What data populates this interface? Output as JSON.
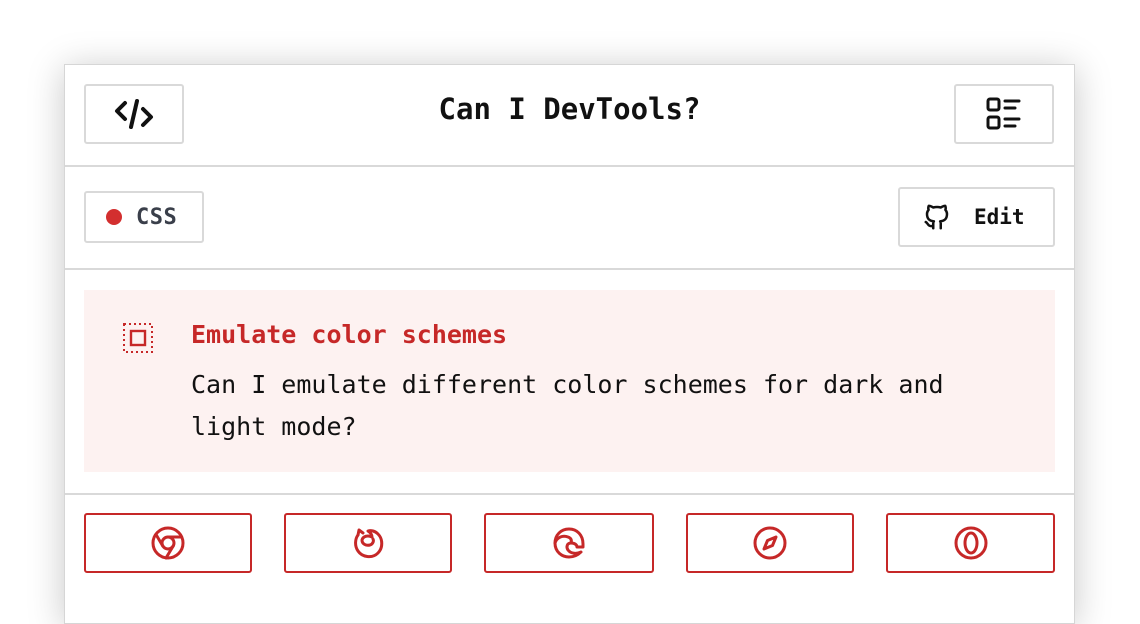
{
  "header": {
    "title": "Can I DevTools?",
    "code_icon": "code-icon",
    "menu_icon": "list-menu-icon"
  },
  "meta": {
    "category": "CSS",
    "category_color": "#d32f2f",
    "edit_label": "Edit",
    "edit_icon": "github-icon"
  },
  "feature": {
    "icon": "dotted-frame-icon",
    "title": "Emulate color schemes",
    "description": "Can I emulate different color schemes for dark and light mode?",
    "accent": "#c62828",
    "background": "#fdf2f1"
  },
  "browsers": [
    {
      "icon": "chrome-icon"
    },
    {
      "icon": "firefox-icon"
    },
    {
      "icon": "edge-icon"
    },
    {
      "icon": "safari-icon"
    },
    {
      "icon": "opera-icon"
    }
  ]
}
